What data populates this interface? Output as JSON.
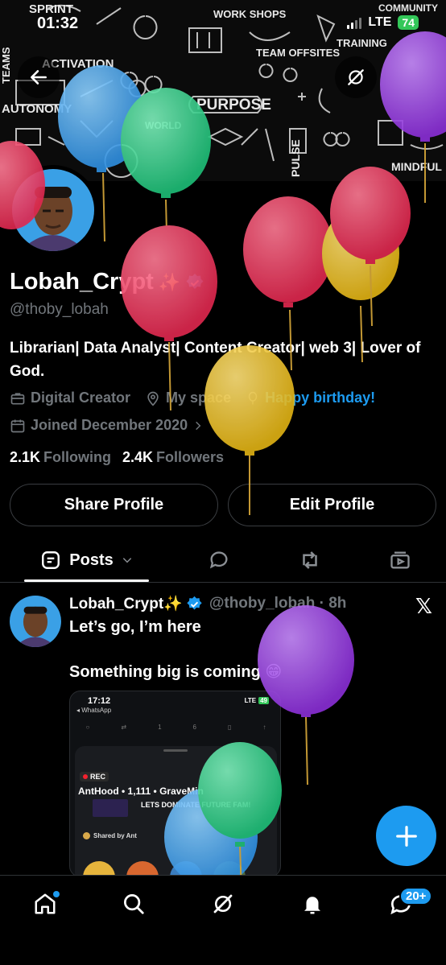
{
  "status_bar": {
    "time": "01:32",
    "network": "LTE",
    "battery": "74"
  },
  "banner": {
    "words": [
      "SPRINT",
      "WORK SHOPS",
      "TEAM OFFSITES",
      "TRAINING",
      "COMMUNITY",
      "TEAMS",
      "ACTIVATION",
      "AUTONOMY",
      "PURPOSE",
      "WORLD",
      "MINDFUL",
      "PULSE"
    ]
  },
  "profile": {
    "display_name": "Lobah_Crypt",
    "sparkle": "✨",
    "handle": "@thoby_lobah",
    "bio": "Librarian| Data Analyst| Content Creator| web 3| Lover of God.",
    "category": "Digital Creator",
    "location": "My space",
    "birthday": "Happy birthday!",
    "joined": "Joined December 2020",
    "following_count": "2.1K",
    "following_label": "Following",
    "followers_count": "2.4K",
    "followers_label": "Followers"
  },
  "buttons": {
    "share": "Share Profile",
    "edit": "Edit Profile"
  },
  "tabs": {
    "posts": "Posts"
  },
  "post": {
    "name": "Lobah_Crypt✨",
    "handle_time": "@thoby_lobah · 8h",
    "line1": "Let’s go, I’m here",
    "line2": "Something big is coming 😁",
    "embed": {
      "time": "17:12",
      "back": "◂ WhatsApp",
      "network": "LTE",
      "battery": "49",
      "rec": "REC",
      "title": "AntHood • 1,111 • GraveMin",
      "subtitle": "LETS DOMINATE FUTURE FAM!",
      "shared": "Shared by Ant",
      "actions": [
        "1",
        "6"
      ]
    }
  },
  "nav": {
    "messages_badge": "20+"
  },
  "colors": {
    "accent": "#1d9bf0",
    "background": "#000000",
    "muted": "#71767b"
  },
  "icons": [
    "back-arrow-icon",
    "grok-icon",
    "briefcase-icon",
    "location-pin-icon",
    "balloon-icon",
    "calendar-icon",
    "verified-badge-icon",
    "reply-icon",
    "repost-icon",
    "media-icon",
    "x-logo-icon",
    "plus-icon",
    "home-icon",
    "search-icon",
    "bell-icon",
    "messages-icon"
  ]
}
